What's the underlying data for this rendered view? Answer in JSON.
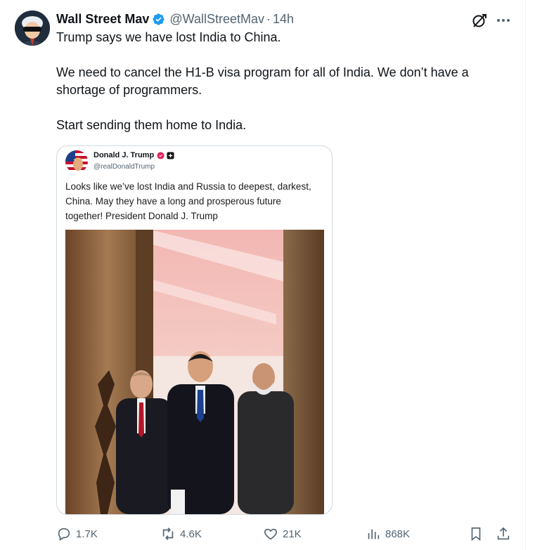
{
  "author": {
    "name": "Wall Street Mav",
    "handle": "@WallStreetMav",
    "separator": "·",
    "time": "14h",
    "avatar_icon": "cartoon-avatar-sunglasses"
  },
  "tweet": {
    "paragraphs": [
      "Trump says we have lost India to China.",
      "We need to cancel the H1-B visa program for all of India. We don’t have a shortage of programmers.",
      "Start sending them home to India."
    ]
  },
  "quoted_post": {
    "name": "Donald J. Trump",
    "handle": "@realDonaldTrump",
    "text": "Looks like we’ve lost India and Russia to deepest, darkest, China. May they have a long and prosperous future together! President Donald J. Trump",
    "photo_icon": "photo-three-leaders-walking"
  },
  "actions": {
    "replies": "1.7K",
    "reposts": "4.6K",
    "likes": "21K",
    "views": "868K"
  },
  "colors": {
    "text": "#0f1419",
    "muted": "#536471",
    "verified": "#1d9bf0",
    "border": "#cfd9de"
  }
}
